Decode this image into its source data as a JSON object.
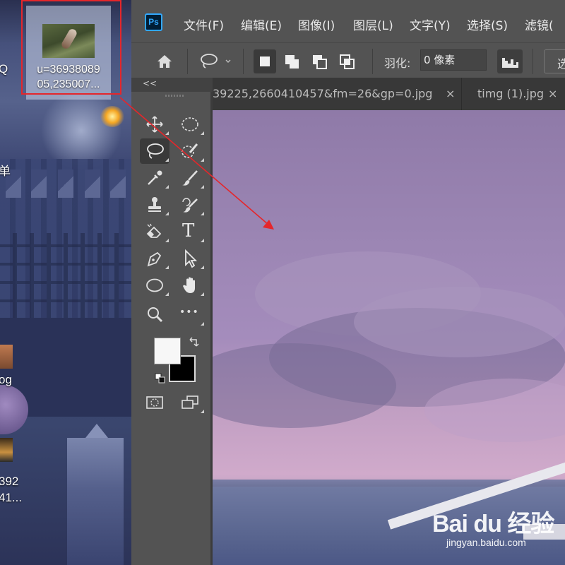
{
  "desktop": {
    "left_labels": [
      "Q",
      "单",
      "og",
      "392",
      "41..."
    ],
    "selected_file": {
      "name_line1": "u=36938089",
      "name_line2": "05,235007..."
    }
  },
  "photoshop": {
    "logo": "Ps",
    "menu": [
      "文件(F)",
      "编辑(E)",
      "图像(I)",
      "图层(L)",
      "文字(Y)",
      "选择(S)",
      "滤镜("
    ],
    "options": {
      "feather_label": "羽化:",
      "feather_value": "0 像素",
      "cut_label": "选"
    },
    "collapse_icon": "<<",
    "tabs": [
      {
        "title": "39225,2660410457&fm=26&gp=0.jpg",
        "close": "×"
      },
      {
        "title": "timg (1).jpg",
        "close": "×"
      }
    ],
    "tools_text": {
      "type_tool": "T",
      "more_tools": "•••"
    }
  },
  "watermark": {
    "brand": "Bai du 经验",
    "url": "jingyan.baidu.com"
  },
  "colors": {
    "annotation_red": "#e5262b",
    "ps_blue": "#31a8ff",
    "panel_gray": "#535353",
    "foreground_color": "#f7f7f7",
    "background_color": "#000000"
  }
}
